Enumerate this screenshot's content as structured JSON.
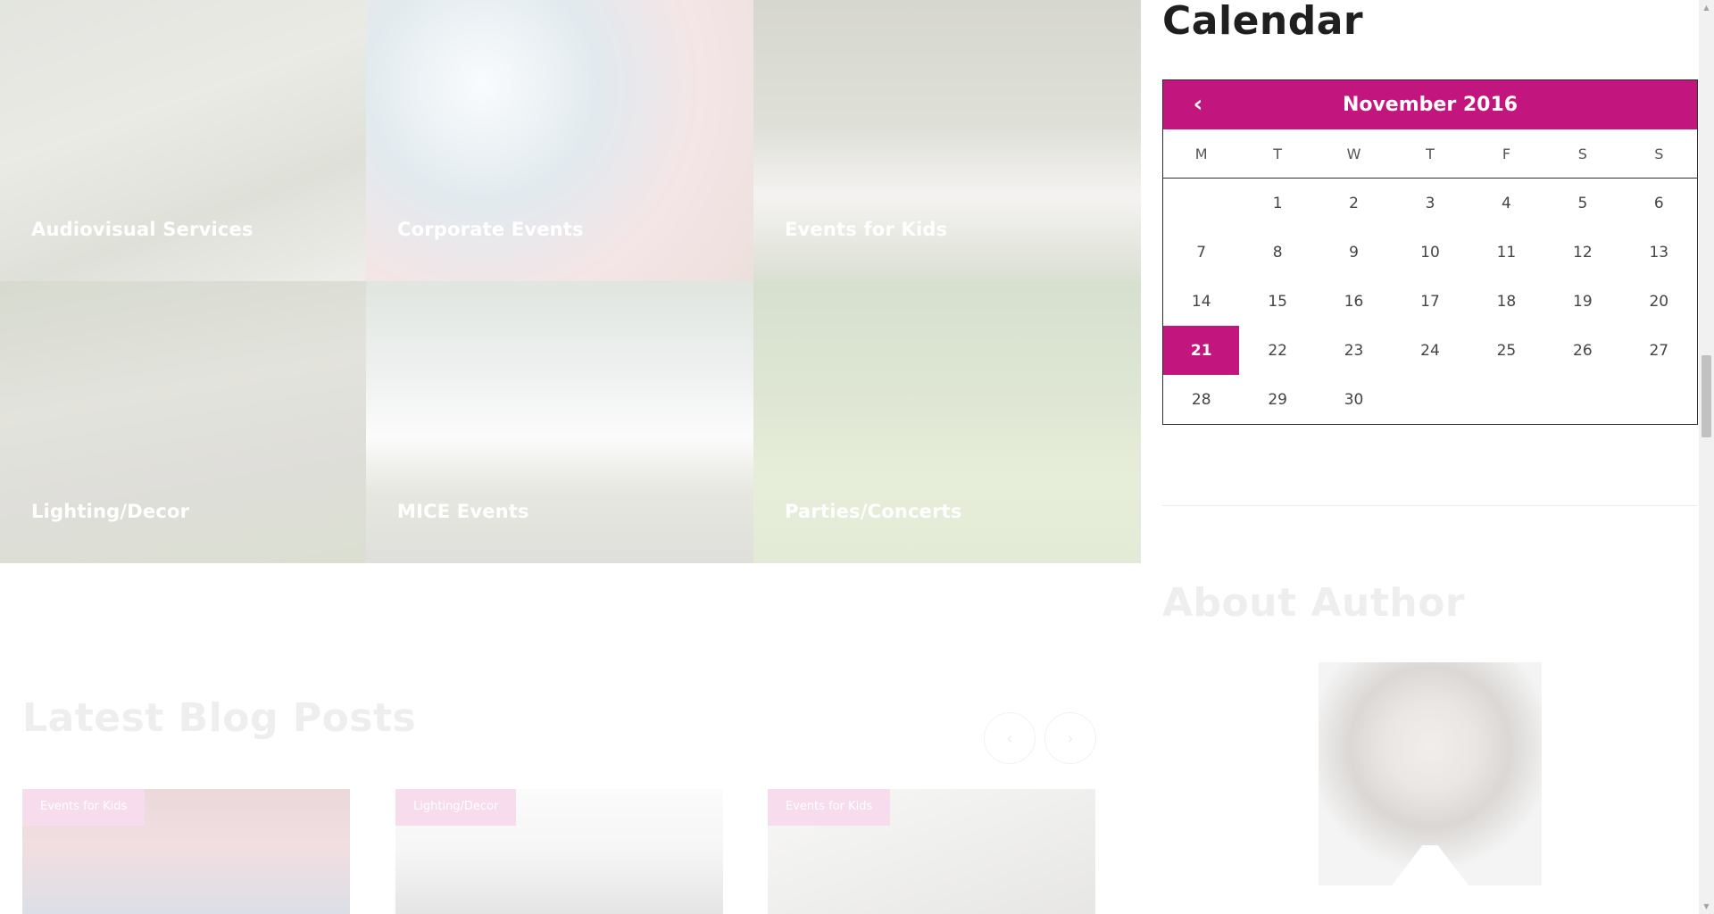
{
  "services": [
    {
      "label": "Audiovisual Services"
    },
    {
      "label": "Corporate Events"
    },
    {
      "label": "Events for Kids"
    },
    {
      "label": "Lighting/Decor"
    },
    {
      "label": "MICE Events"
    },
    {
      "label": "Parties/Concerts"
    }
  ],
  "blog": {
    "title": "Latest Blog Posts",
    "prev_icon": "‹",
    "next_icon": "›",
    "cards": [
      {
        "tag": "Events for Kids"
      },
      {
        "tag": "Lighting/Decor"
      },
      {
        "tag": "Events for Kids"
      }
    ]
  },
  "sidebar": {
    "calendar": {
      "heading": "Calendar",
      "month_label": "November 2016",
      "prev_icon": "‹",
      "weekdays": [
        "M",
        "T",
        "W",
        "T",
        "F",
        "S",
        "S"
      ],
      "days": [
        "",
        "1",
        "2",
        "3",
        "4",
        "5",
        "6",
        "7",
        "8",
        "9",
        "10",
        "11",
        "12",
        "13",
        "14",
        "15",
        "16",
        "17",
        "18",
        "19",
        "20",
        "21",
        "22",
        "23",
        "24",
        "25",
        "26",
        "27",
        "28",
        "29",
        "30",
        "",
        "",
        "",
        ""
      ],
      "today": "21",
      "accent_color": "#c2157d"
    },
    "author": {
      "heading": "About Author"
    }
  }
}
